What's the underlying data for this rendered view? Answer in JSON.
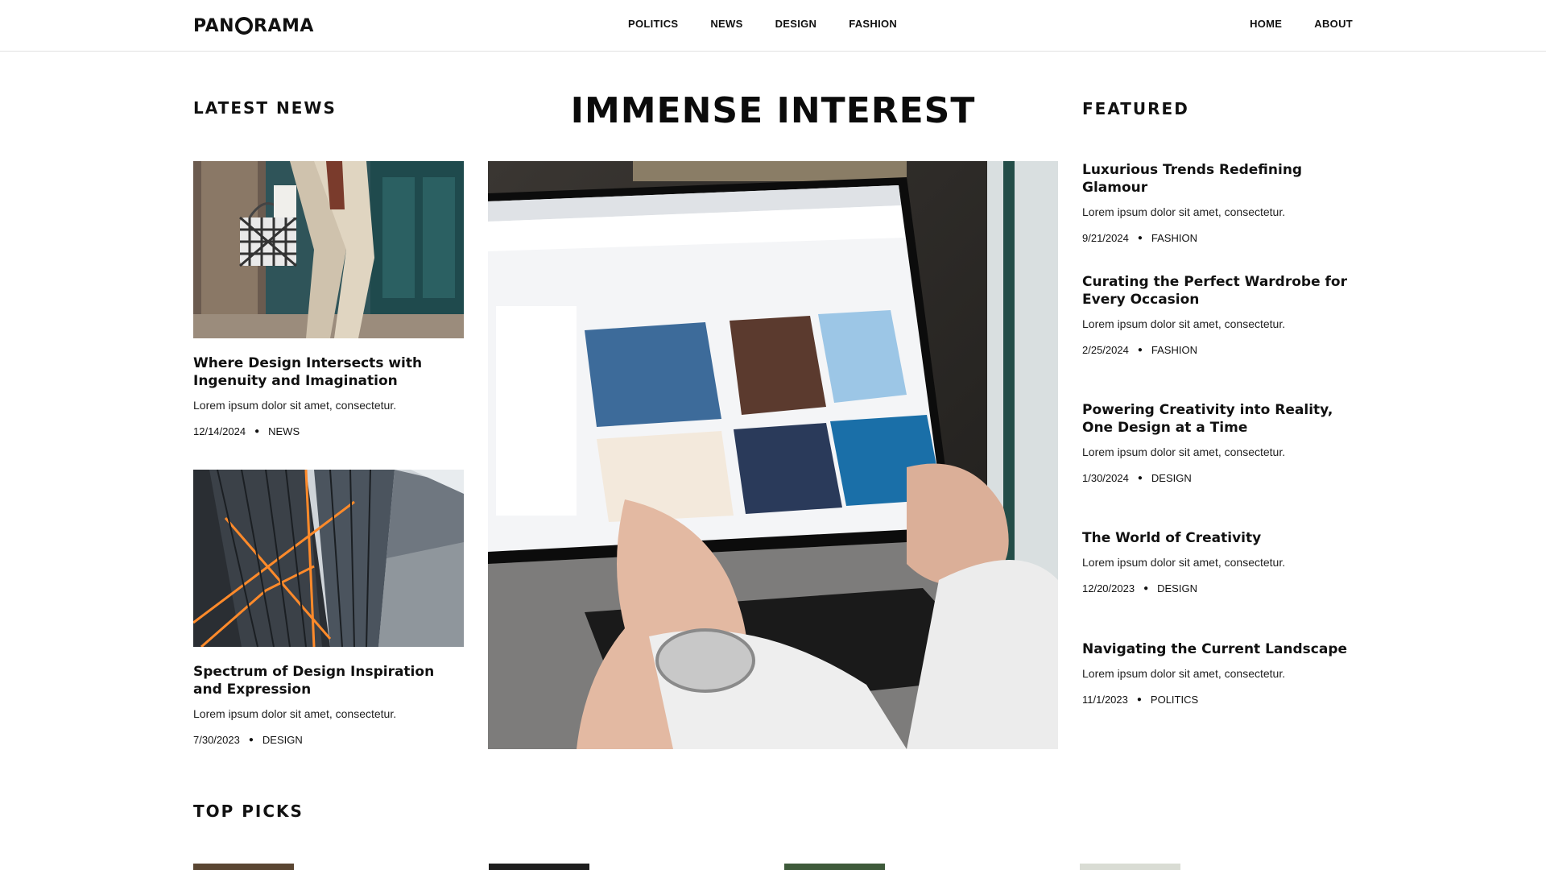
{
  "header": {
    "logo_text_left": "PAN",
    "logo_text_right": "RAMA",
    "nav_center": [
      "POLITICS",
      "NEWS",
      "DESIGN",
      "FASHION"
    ],
    "nav_right": [
      "HOME",
      "ABOUT"
    ]
  },
  "latest": {
    "heading": "LATEST NEWS",
    "items": [
      {
        "title": "Where Design Intersects with Ingenuity and Imagination",
        "excerpt": "Lorem ipsum dolor sit amet, consectetur.",
        "date": "12/14/2024",
        "category": "NEWS"
      },
      {
        "title": "Spectrum of Design Inspiration and Expression",
        "excerpt": "Lorem ipsum dolor sit amet, consectetur.",
        "date": "7/30/2023",
        "category": "DESIGN"
      }
    ]
  },
  "hero": {
    "title": "IMMENSE INTEREST"
  },
  "featured": {
    "heading": "FEATURED",
    "items": [
      {
        "title": "Luxurious Trends Redefining Glamour",
        "excerpt": "Lorem ipsum dolor sit amet, consectetur.",
        "date": "9/21/2024",
        "category": "FASHION"
      },
      {
        "title": "Curating the Perfect Wardrobe for Every Occasion",
        "excerpt": "Lorem ipsum dolor sit amet, consectetur.",
        "date": "2/25/2024",
        "category": "FASHION"
      },
      {
        "title": "Powering Creativity into Reality, One Design at a Time",
        "excerpt": "Lorem ipsum dolor sit amet, consectetur.",
        "date": "1/30/2024",
        "category": "DESIGN"
      },
      {
        "title": "The World of Creativity",
        "excerpt": "Lorem ipsum dolor sit amet, consectetur.",
        "date": "12/20/2023",
        "category": "DESIGN"
      },
      {
        "title": "Navigating the Current Landscape",
        "excerpt": "Lorem ipsum dolor sit amet, consectetur.",
        "date": "11/1/2023",
        "category": "POLITICS"
      }
    ]
  },
  "top_picks": {
    "heading": "TOP PICKS"
  },
  "colors": {
    "text": "#111111",
    "border": "#e2e2e2",
    "background": "#ffffff"
  }
}
